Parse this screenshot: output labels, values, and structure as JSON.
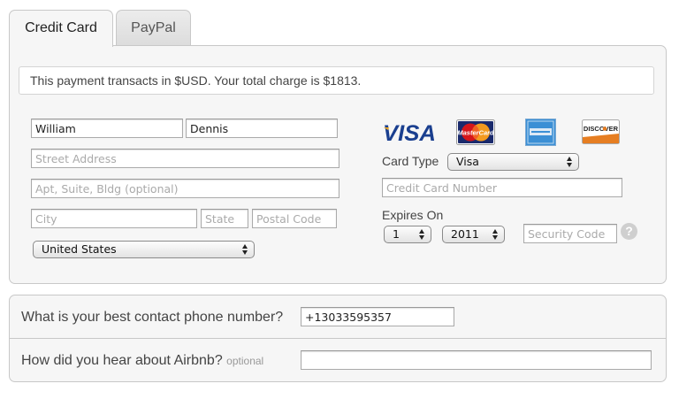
{
  "tabs": [
    {
      "label": "Credit Card",
      "active": true
    },
    {
      "label": "PayPal",
      "active": false
    }
  ],
  "notice": "This payment transacts in $USD. Your total charge is $1813.",
  "billing": {
    "first_name": "William",
    "last_name": "Dennis",
    "street_placeholder": "Street Address",
    "apt_placeholder": "Apt, Suite, Bldg (optional)",
    "city_placeholder": "City",
    "state_placeholder": "State",
    "postal_placeholder": "Postal Code",
    "country": "United States"
  },
  "card": {
    "logos": [
      "visa-logo",
      "mastercard-logo",
      "amex-logo",
      "discover-logo"
    ],
    "type_label": "Card Type",
    "type_value": "Visa",
    "number_placeholder": "Credit Card Number",
    "expires_label": "Expires On",
    "month": "1",
    "year": "2011",
    "security_placeholder": "Security Code",
    "help_glyph": "?"
  },
  "phone": {
    "question": "What is your best contact phone number?",
    "value": "+13033595357"
  },
  "referral": {
    "question": "How did you hear about Airbnb?",
    "optional": "optional",
    "value": ""
  },
  "colors": {
    "visa_blue": "#1a3f8f",
    "visa_gold": "#e9a420",
    "mc_red": "#d5161b",
    "mc_orange": "#f39a1f",
    "amex_blue": "#3b8fd5",
    "discover_orange": "#e67e22"
  }
}
